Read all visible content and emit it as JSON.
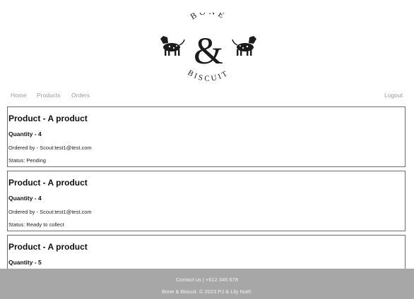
{
  "brand": {
    "logo_text_top": "BONE",
    "logo_text_bottom": "BISCUIT",
    "logo_ampersand": "&"
  },
  "nav": {
    "home": "Home",
    "products": "Products",
    "orders": "Orders",
    "logout": "Logout"
  },
  "orders": [
    {
      "product": "Product - A product",
      "quantity": "Quantity - 4",
      "ordered_by": "Ordered by - Scout:test1@test.com",
      "status": "Status: Pending"
    },
    {
      "product": "Product - A product",
      "quantity": "Quantity - 4",
      "ordered_by": "Ordered by - Scout:test1@test.com",
      "status": "Status: Ready to collect"
    },
    {
      "product": "Product - A product",
      "quantity": "Quantity - 5",
      "ordered_by": "",
      "status": ""
    }
  ],
  "footer": {
    "contact": "Contact us | +612 345 678",
    "copyright": "Bone & Biscuit. © 2023 PJ & Lily Noël."
  },
  "colors": {
    "footer_bg": "#a7a7a7",
    "card_border": "#6e6e6e",
    "nav_text": "#9a9a9a"
  }
}
